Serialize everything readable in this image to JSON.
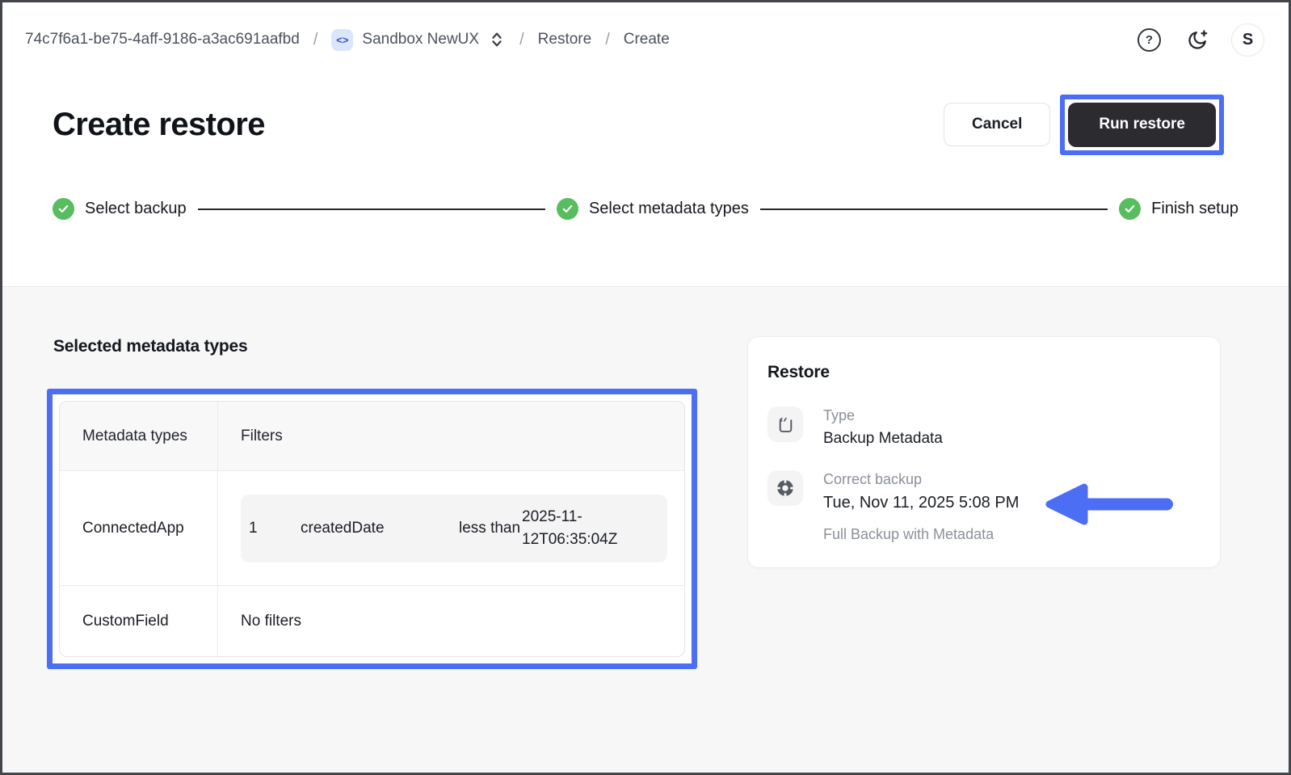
{
  "breadcrumb": {
    "org_id": "74c7f6a1-be75-4aff-9186-a3ac691aafbd",
    "separator": "/",
    "env_icon_glyph": "<>",
    "environment": "Sandbox NewUX",
    "section": "Restore",
    "page": "Create"
  },
  "header_actions": {
    "help_glyph": "?",
    "avatar_initial": "S"
  },
  "page": {
    "title": "Create restore",
    "cancel_label": "Cancel",
    "run_label": "Run restore"
  },
  "stepper": {
    "steps": [
      {
        "label": "Select backup",
        "completed": true
      },
      {
        "label": "Select metadata types",
        "completed": true
      },
      {
        "label": "Finish setup",
        "completed": true
      }
    ]
  },
  "main": {
    "section_title": "Selected metadata types",
    "table": {
      "columns": [
        "Metadata types",
        "Filters"
      ],
      "rows": [
        {
          "type": "ConnectedApp",
          "filter": {
            "index": "1",
            "field": "createdDate",
            "operator": "less than",
            "value": "2025-11-12T06:35:04Z"
          }
        },
        {
          "type": "CustomField",
          "filters_text": "No filters"
        }
      ]
    },
    "summary_card": {
      "title": "Restore",
      "items": [
        {
          "icon": "metadata-backup-icon",
          "label": "Type",
          "value": "Backup Metadata"
        },
        {
          "icon": "lifebuoy-icon",
          "label": "Correct backup",
          "value": "Tue, Nov 11, 2025 5:08 PM",
          "sub": "Full Backup with Metadata"
        }
      ]
    }
  },
  "colors": {
    "annotation_blue": "#4b6ef5",
    "step_green": "#58bd5e",
    "dark_button": "#2b2b30",
    "light_blue_pill": "#dbe5fb",
    "gray_background": "#f7f7f8"
  }
}
